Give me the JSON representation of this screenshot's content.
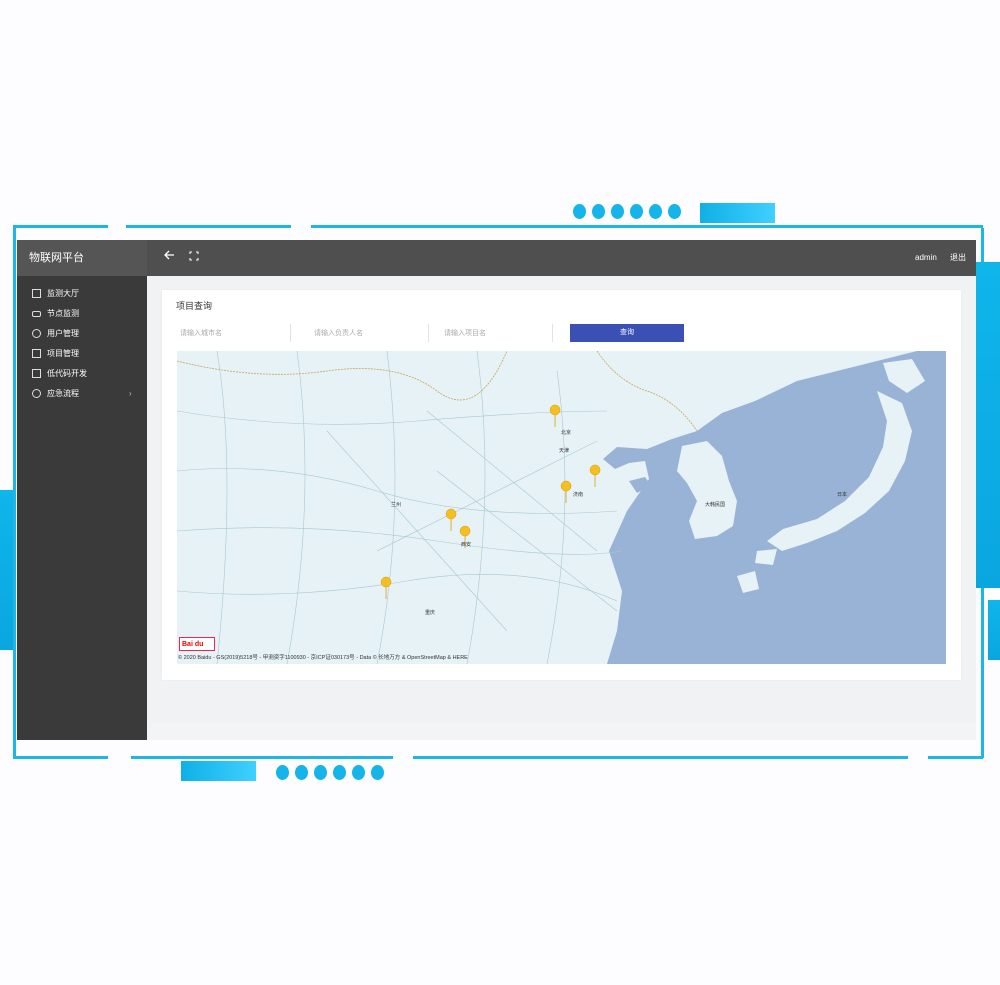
{
  "header": {
    "brand": "物联网平台",
    "back_icon": "arrow-left-icon",
    "fullscreen_icon": "fullscreen-icon",
    "user": "admin",
    "logout": "退出"
  },
  "sidebar": {
    "items": [
      {
        "label": "监测大厅",
        "icon": "chart-icon"
      },
      {
        "label": "节点监测",
        "icon": "monitor-icon"
      },
      {
        "label": "用户管理",
        "icon": "user-icon"
      },
      {
        "label": "项目管理",
        "icon": "edit-icon"
      },
      {
        "label": "低代码开发",
        "icon": "code-icon"
      },
      {
        "label": "应急流程",
        "icon": "flow-icon",
        "arrow": "›"
      }
    ]
  },
  "search": {
    "title": "项目查询",
    "city_placeholder": "请输入城市名",
    "owner_placeholder": "请输入负责人名",
    "project_placeholder": "请输入项目名",
    "query_button": "查询"
  },
  "map": {
    "logo": "Bai du",
    "copyright": "© 2020 Baidu - GS(2019)5218号 - 甲测资字1100930 - 京ICP证030173号 - Data © 长地万方 & OpenStreetMap & HERE",
    "labels": {
      "beijing": "北京",
      "tianjin": "天津",
      "jinan": "济南",
      "xian": "西安",
      "chongqing": "重庆",
      "lanzhou": "兰州",
      "korea": "大韩民国",
      "japan": "日本"
    },
    "colors": {
      "land": "#e6f2f6",
      "sea": "#98b3d6",
      "road": "#a8c8cf",
      "marker": "#f5bf22"
    }
  }
}
